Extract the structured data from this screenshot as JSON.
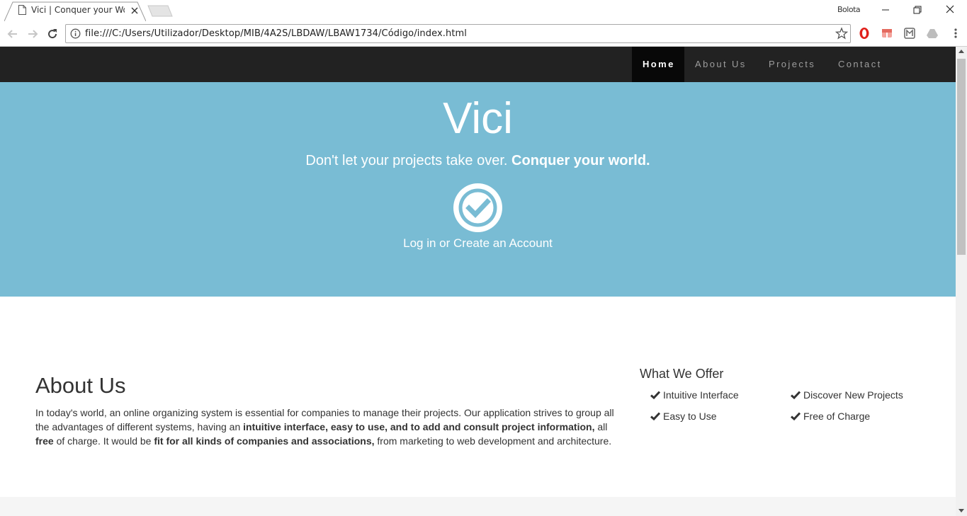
{
  "browser": {
    "tab_title": "Vici | Conquer your World",
    "profile_name": "Bolota",
    "url": "file:///C:/Users/Utilizador/Desktop/MIB/4A2S/LBDAW/LBAW1734/Código/index.html"
  },
  "nav": {
    "items": [
      {
        "label": "Home",
        "active": true
      },
      {
        "label": "About Us",
        "active": false
      },
      {
        "label": "Projects",
        "active": false
      },
      {
        "label": "Contact",
        "active": false
      }
    ]
  },
  "hero": {
    "title": "Vici",
    "subtitle_plain": "Don't let your projects take over.",
    "subtitle_bold": "Conquer your world.",
    "icon": "check-circle-icon",
    "link": "Log in or Create an Account",
    "background": "#79bcd4"
  },
  "about": {
    "title": "About Us",
    "p1": "In today's world, an online organizing system is essential for companies to manage their projects. Our application strives to group all the advantages of different systems, having an",
    "b1": "intuitive interface, easy to use, and to add and consult project information,",
    "p2": "all",
    "b2": "free",
    "p3": "of charge. It would be",
    "b3": "fit for all kinds of companies and associations,",
    "p4": "from marketing to web development and architecture."
  },
  "offer": {
    "title": "What We Offer",
    "items": [
      "Intuitive Interface",
      "Discover New Projects",
      "Easy to Use",
      "Free of Charge"
    ]
  }
}
